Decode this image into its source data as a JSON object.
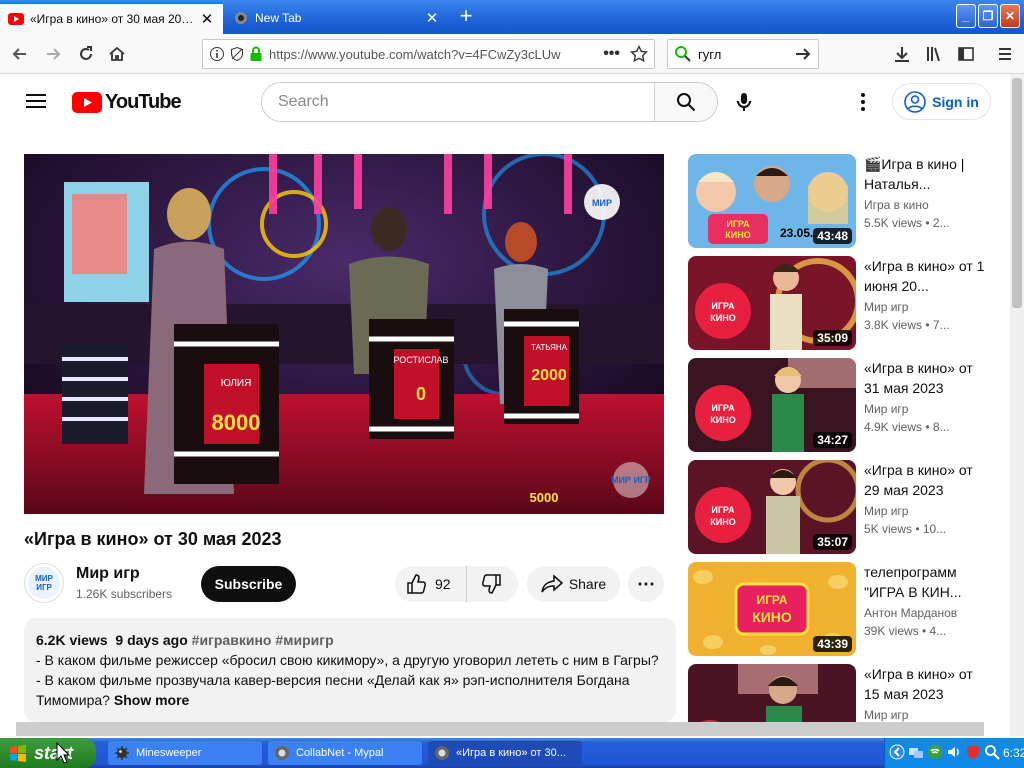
{
  "browser": {
    "tabs": [
      {
        "label": "«Игра в кино» от 30 мая 2023 - Y"
      },
      {
        "label": "New Tab"
      }
    ],
    "url": "https://www.youtube.com/watch?v=4FCwZy3cLUw",
    "search_value": "гугл"
  },
  "yt": {
    "logo_text": "YouTube",
    "search_placeholder": "Search",
    "signin_label": "Sign in",
    "brand_color": "#ff0000"
  },
  "video": {
    "title": "«Игра в кино» от 30 мая 2023",
    "channel": "Мир игр",
    "subscribers": "1.26K subscribers",
    "subscribe_label": "Subscribe",
    "likes": "92",
    "share_label": "Share",
    "more_label": "⋯",
    "views": "6.2K views",
    "age": "9 days ago",
    "tags": "#игравкино #миригр",
    "desc_line1": "- В каком фильме режиссер «бросил свою кикимору», а другую уговорил лететь с ним в Гагры?",
    "desc_line2": "- В каком фильме прозвучала кавер-версия песни «Делай как я» рэп-исполнителя Богдана",
    "desc_line3": "Тимомира?",
    "show_more": "Show more",
    "podium": [
      {
        "name": "ЮЛИЯ",
        "score": "8000"
      },
      {
        "name": "РОСТИСЛАВ",
        "score": "0"
      },
      {
        "name": "ТАТЬЯНА",
        "score": "2000"
      }
    ],
    "watermark": "МИР ИГР",
    "logo_top": "МИР",
    "corner_score": "5000"
  },
  "related": [
    {
      "title": "🎬Игра в кино | Наталья...",
      "channel": "Игра в кино",
      "meta": "5.5K views  •  2...",
      "duration": "43:48",
      "date_badge": "23.05."
    },
    {
      "title": "«Игра в кино» от 1 июня 20...",
      "channel": "Мир игр",
      "meta": "3.8K views  •  7...",
      "duration": "35:09"
    },
    {
      "title": "«Игра в кино» от 31 мая 2023",
      "channel": "Мир игр",
      "meta": "4.9K views  •  8...",
      "duration": "34:27"
    },
    {
      "title": "«Игра в кино» от 29 мая 2023",
      "channel": "Мир игр",
      "meta": "5K views  •  10...",
      "duration": "35:07"
    },
    {
      "title": "телепрограмм \"ИГРА В КИН...",
      "channel": "Антон Марданов",
      "meta": "39K views  •  4...",
      "duration": "43:39"
    },
    {
      "title": "«Игра в кино» от 15 мая 2023",
      "channel": "Мир игр",
      "meta": "",
      "duration": ""
    }
  ],
  "taskbar": {
    "start_label": "start",
    "tasks": [
      {
        "label": "Minesweeper"
      },
      {
        "label": "CollabNet - Mypal"
      },
      {
        "label": "«Игра в кино» от 30..."
      }
    ],
    "clock": "6:32"
  }
}
